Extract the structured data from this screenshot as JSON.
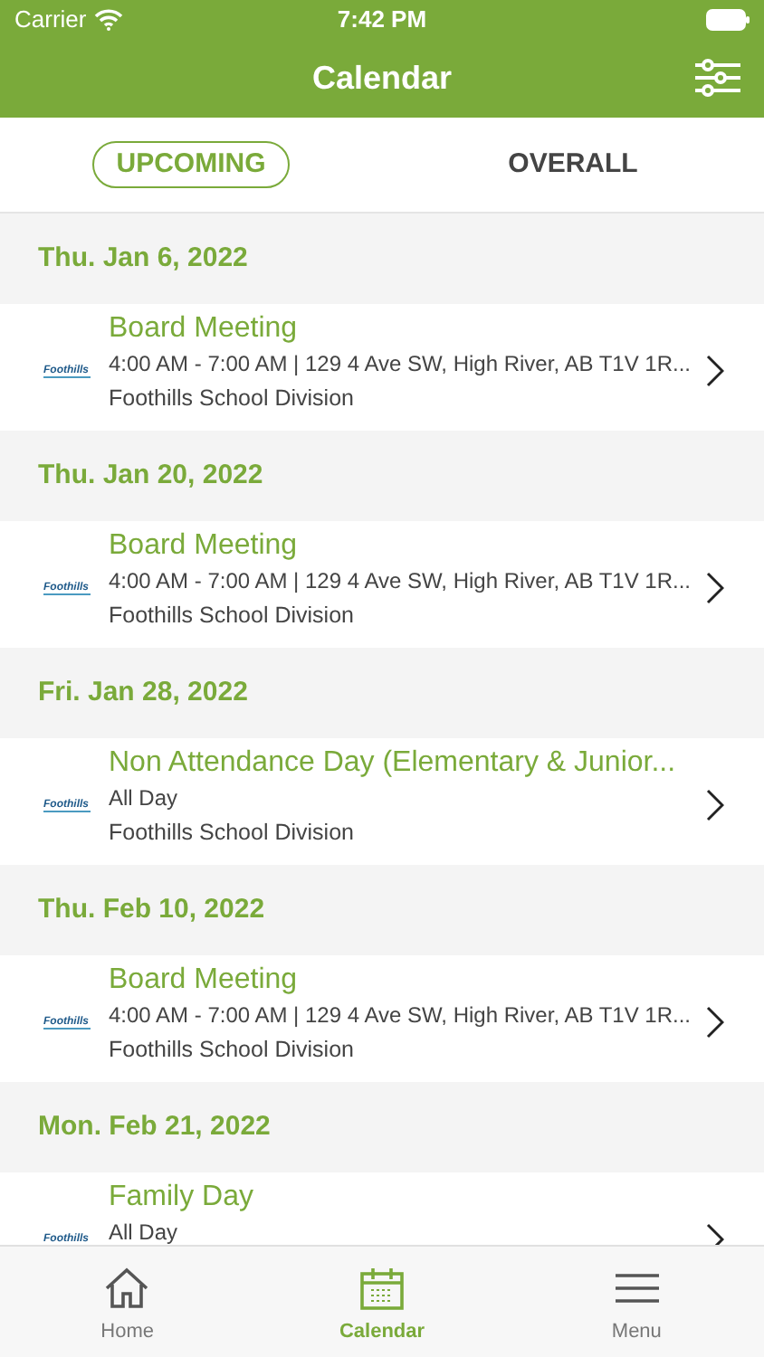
{
  "status_bar": {
    "carrier": "Carrier",
    "time": "7:42 PM"
  },
  "header": {
    "title": "Calendar"
  },
  "tabs": [
    {
      "label": "UPCOMING",
      "selected": true
    },
    {
      "label": "OVERALL",
      "selected": false
    }
  ],
  "days": [
    {
      "date": "Thu. Jan 6, 2022",
      "events": [
        {
          "logo_text": "Foothills",
          "title": "Board Meeting",
          "details": "4:00 AM - 7:00 AM | 129 4 Ave SW, High River, AB T1V 1R...",
          "organizer": "Foothills School Division"
        }
      ]
    },
    {
      "date": "Thu. Jan 20, 2022",
      "events": [
        {
          "logo_text": "Foothills",
          "title": "Board Meeting",
          "details": "4:00 AM - 7:00 AM | 129 4 Ave SW, High River, AB T1V 1R...",
          "organizer": "Foothills School Division"
        }
      ]
    },
    {
      "date": "Fri. Jan 28, 2022",
      "events": [
        {
          "logo_text": "Foothills",
          "title": "Non Attendance Day (Elementary & Junior...",
          "details": "All Day",
          "organizer": "Foothills School Division"
        }
      ]
    },
    {
      "date": "Thu. Feb 10, 2022",
      "events": [
        {
          "logo_text": "Foothills",
          "title": "Board Meeting",
          "details": "4:00 AM - 7:00 AM | 129 4 Ave SW, High River, AB T1V 1R...",
          "organizer": "Foothills School Division"
        }
      ]
    },
    {
      "date": "Mon. Feb 21, 2022",
      "events": [
        {
          "logo_text": "Foothills",
          "title": "Family Day",
          "details": "All Day"
        }
      ]
    }
  ],
  "tab_bar": [
    {
      "kind": "home",
      "label": "Home",
      "selected": false
    },
    {
      "kind": "calendar",
      "label": "Calendar",
      "selected": true
    },
    {
      "kind": "menu",
      "label": "Menu",
      "selected": false
    }
  ]
}
